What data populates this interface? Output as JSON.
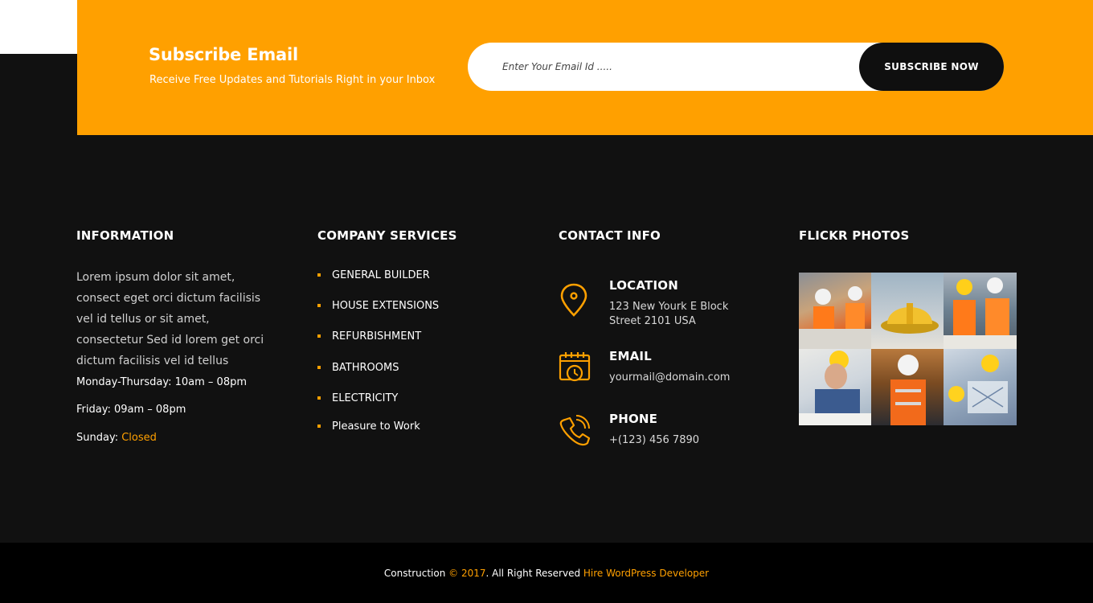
{
  "subscribe": {
    "title": "Subscribe Email",
    "subtitle": "Receive Free Updates and Tutorials Right in your Inbox",
    "email_placeholder": "Enter Your Email Id .....",
    "button_label": "SUBSCRIBE NOW"
  },
  "information": {
    "title": "INFORMATION",
    "text": "Lorem ipsum dolor sit amet, consect eget orci dictum facilisis vel id tellus or sit amet, consectetur Sed id lorem get orci dictum facilisis vel id tellus",
    "hours_1": "Monday-Thursday: 10am – 08pm",
    "hours_2": "Friday: 09am – 08pm",
    "hours_3_label": "Sunday: ",
    "hours_3_value": "Closed"
  },
  "services": {
    "title": "COMPANY SERVICES",
    "items": [
      "GENERAL BUILDER",
      "HOUSE EXTENSIONS",
      "REFURBISHMENT",
      "BATHROOMS",
      "ELECTRICITY",
      "Pleasure to Work"
    ]
  },
  "contact": {
    "title": "CONTACT INFO",
    "location_label": "LOCATION",
    "location_line1": "123 New Yourk E Block",
    "location_line2": "Street 2101 USA",
    "email_label": "EMAIL",
    "email_value": "yourmail@domain.com",
    "phone_label": "PHONE",
    "phone_value": "+(123) 456 7890",
    "icons": [
      "map-pin-icon",
      "calendar-clock-icon",
      "phone-icon"
    ]
  },
  "flickr": {
    "title": "FLICKR PHOTOS",
    "photo_count": 6
  },
  "footer": {
    "brand": "Construction",
    "year": "© 2017",
    "rights": ". All Right Reserved ",
    "link": "Hire WordPress Developer"
  },
  "colors": {
    "accent": "#ffa000",
    "background": "#111111",
    "bottom_bar": "#000000"
  }
}
